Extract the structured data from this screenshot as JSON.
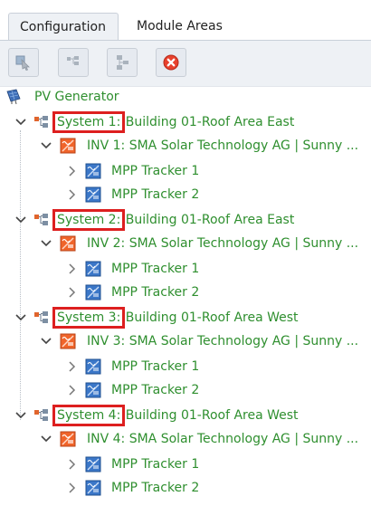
{
  "tabs": [
    {
      "label": "Configuration",
      "active": true
    },
    {
      "label": "Module Areas",
      "active": false
    }
  ],
  "toolbar": {
    "buttons": [
      {
        "icon": "select-module-icon",
        "enabled": false
      },
      {
        "icon": "add-system-icon",
        "enabled": false
      },
      {
        "icon": "add-inverter-icon",
        "enabled": false
      },
      {
        "icon": "delete-icon",
        "enabled": true
      }
    ]
  },
  "tree": {
    "root": "PV Generator",
    "systems": [
      {
        "system_label": "System 1:",
        "area": "Building 01-Roof Area East",
        "inverter": "INV 1: SMA Solar Technology AG | Sunny ...",
        "trackers": [
          "MPP Tracker 1",
          "MPP Tracker 2"
        ]
      },
      {
        "system_label": "System 2:",
        "area": "Building 01-Roof Area East",
        "inverter": "INV 2: SMA Solar Technology AG | Sunny ...",
        "trackers": [
          "MPP Tracker 1",
          "MPP Tracker 2"
        ]
      },
      {
        "system_label": "System 3:",
        "area": "Building 01-Roof Area West",
        "inverter": "INV 3: SMA Solar Technology AG | Sunny ...",
        "trackers": [
          "MPP Tracker 1",
          "MPP Tracker 2"
        ]
      },
      {
        "system_label": "System 4:",
        "area": "Building 01-Roof Area West",
        "inverter": "INV 4: SMA Solar Technology AG | Sunny ...",
        "trackers": [
          "MPP Tracker 1",
          "MPP Tracker 2"
        ]
      }
    ]
  },
  "colors": {
    "tree_text": "#2f8f2f",
    "highlight_box": "#dd1f1f",
    "toolbar_bg": "#eef1f5"
  }
}
